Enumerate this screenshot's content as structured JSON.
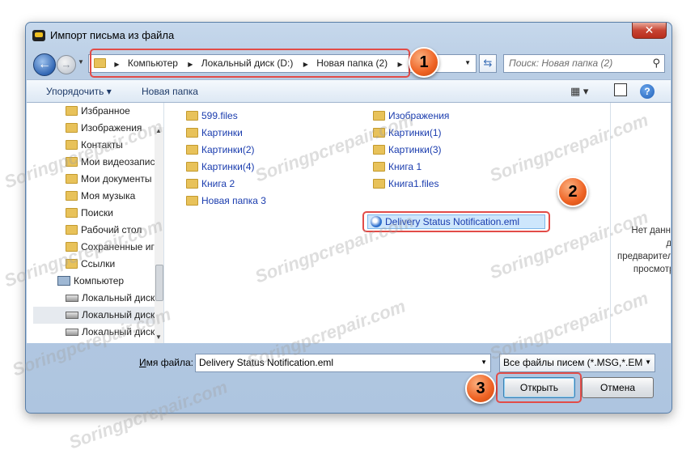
{
  "window": {
    "title": "Импорт письма из файла",
    "close_glyph": "✕"
  },
  "address": {
    "crumbs": [
      "Компьютер",
      "Локальный диск (D:)",
      "Новая папка (2)"
    ],
    "search_placeholder": "Поиск: Новая папка (2)"
  },
  "toolbar": {
    "organize": "Упорядочить",
    "new_folder": "Новая папка"
  },
  "nav_pane": {
    "items": [
      {
        "label": "Избранное",
        "icon": "folder-icon"
      },
      {
        "label": "Изображения",
        "icon": "folder-icon"
      },
      {
        "label": "Контакты",
        "icon": "folder-icon"
      },
      {
        "label": "Мои видеозапис",
        "icon": "folder-icon"
      },
      {
        "label": "Мои документы",
        "icon": "folder-icon"
      },
      {
        "label": "Моя музыка",
        "icon": "folder-icon"
      },
      {
        "label": "Поиски",
        "icon": "folder-icon"
      },
      {
        "label": "Рабочий стол",
        "icon": "folder-icon"
      },
      {
        "label": "Сохраненные иг",
        "icon": "folder-icon"
      },
      {
        "label": "Ссылки",
        "icon": "folder-icon"
      },
      {
        "label": "Компьютер",
        "icon": "computer-icon"
      },
      {
        "label": "Локальный диск",
        "icon": "disk-icon"
      },
      {
        "label": "Локальный диск",
        "icon": "disk-icon"
      },
      {
        "label": "Локальный диск",
        "icon": "disk-icon"
      }
    ]
  },
  "files": {
    "left": [
      "599.files",
      "Картинки",
      "Картинки(2)",
      "Картинки(4)",
      "Книга 2",
      "Новая папка 3"
    ],
    "right": [
      "Изображения",
      "Картинки(1)",
      "Картинки(3)",
      "Книга 1",
      "Книга1.files"
    ],
    "selected": "Delivery Status Notification.eml"
  },
  "preview": {
    "text": "Нет данных для предварительного просмотра."
  },
  "bottom": {
    "filename_label_underlined": "И",
    "filename_label_rest": "мя файла:",
    "filename_value": "Delivery Status Notification.eml",
    "filter_value": "Все файлы писем (*.MSG,*.EM",
    "open_label": "Открыть",
    "cancel_label": "Отмена"
  },
  "annotations": {
    "badge_1": "1",
    "badge_2": "2",
    "badge_3": "3"
  },
  "watermark": "Soringpcrepair.com",
  "colors": {
    "highlight_red": "#e24c48",
    "badge_orange": "#ee6223",
    "link_blue": "#1a3cae"
  }
}
